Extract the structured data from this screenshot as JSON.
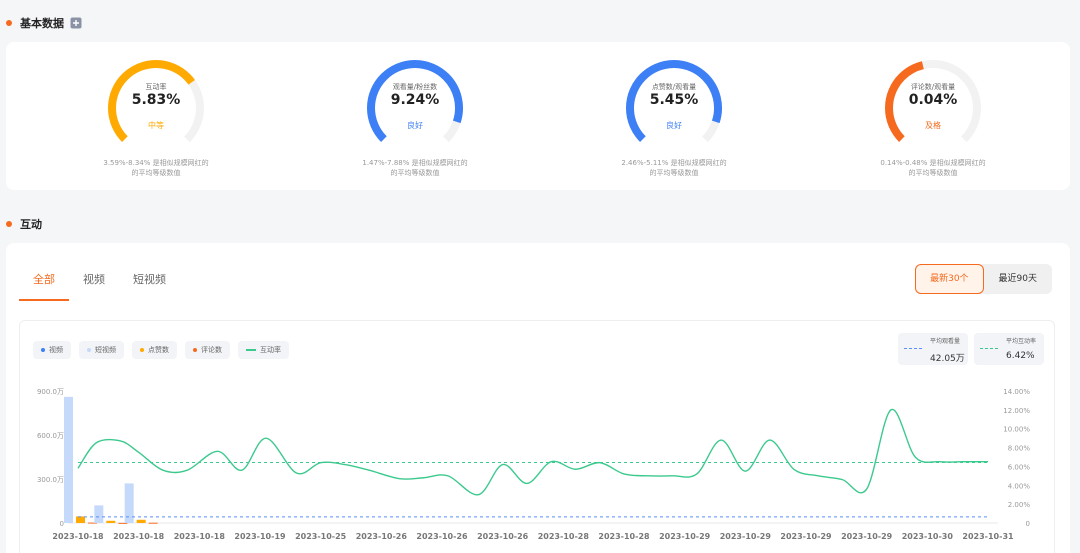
{
  "sections": {
    "basic_title": "基本数据",
    "interact_title": "互动"
  },
  "metrics": [
    {
      "label": "互动率",
      "value": "5.83%",
      "grade": "中等",
      "color": "#ffaa00",
      "ratio": 0.7,
      "desc_line1": "3.59%-8.34% 是相似规模网红的",
      "desc_line2": "的平均等级数值"
    },
    {
      "label": "观看量/粉丝数",
      "value": "9.24%",
      "grade": "良好",
      "color": "#3d7ff5",
      "ratio": 0.9,
      "desc_line1": "1.47%-7.88% 是相似规模网红的",
      "desc_line2": "的平均等级数值"
    },
    {
      "label": "点赞数/观看量",
      "value": "5.45%",
      "grade": "良好",
      "color": "#3d7ff5",
      "ratio": 0.9,
      "desc_line1": "2.46%-5.11% 是相似规模网红的",
      "desc_line2": "的平均等级数值"
    },
    {
      "label": "评论数/观看量",
      "value": "0.04%",
      "grade": "及格",
      "color": "#f56a1f",
      "ratio": 0.45,
      "desc_line1": "0.14%-0.48% 是相似规模网红的",
      "desc_line2": "的平均等级数值"
    }
  ],
  "tabs": [
    "全部",
    "视频",
    "短视频"
  ],
  "range": {
    "recent30": "最新30个",
    "recent90": "最近90天"
  },
  "legend": [
    {
      "label": "视频",
      "color": "#3d7ff5",
      "kind": "dot"
    },
    {
      "label": "短视频",
      "color": "#c5d9fb",
      "kind": "dot"
    },
    {
      "label": "点赞数",
      "color": "#ffaa00",
      "kind": "dot"
    },
    {
      "label": "评论数",
      "color": "#f56a1f",
      "kind": "dot"
    },
    {
      "label": "互动率",
      "color": "#3cc98e",
      "kind": "line"
    }
  ],
  "avg": {
    "views_title": "平均观看量",
    "views_value": "42.05万",
    "views_color": "#5b8ff9",
    "rate_title": "平均互动率",
    "rate_value": "6.42%",
    "rate_color": "#3cc98e"
  },
  "chart_data": {
    "type": "bar",
    "categories": [
      "2023-10-18",
      "2023-10-18",
      "2023-10-18",
      "2023-10-19",
      "2023-10-25",
      "2023-10-26",
      "2023-10-26",
      "2023-10-26",
      "2023-10-28",
      "2023-10-28",
      "2023-10-29",
      "2023-10-29",
      "2023-10-29",
      "2023-10-29",
      "2023-10-30",
      "2023-10-31"
    ],
    "y_left_ticks": [
      "0",
      "300.0万",
      "600.0万",
      "900.0万"
    ],
    "y_left_max": 900,
    "y_right_ticks": [
      "0",
      "2.00%",
      "4.00%",
      "6.00%",
      "8.00%",
      "10.00%",
      "12.00%",
      "14.00%"
    ],
    "y_right_max": 14,
    "bars": [
      {
        "x": 0,
        "short_video": 860,
        "likes": 45,
        "comments": 3
      },
      {
        "x": 0.5,
        "short_video": 120,
        "likes": 15,
        "comments": 1
      },
      {
        "x": 1,
        "short_video": 270,
        "likes": 22,
        "comments": 2
      }
    ],
    "interaction_rate_x": [
      0,
      0.3,
      0.7,
      1,
      1.4,
      1.8,
      2.3,
      2.7,
      3.1,
      3.6,
      4,
      4.4,
      4.8,
      5.3,
      5.7,
      6.1,
      6.6,
      7,
      7.4,
      7.8,
      8.2,
      8.6,
      9,
      9.4,
      9.8,
      10.2,
      10.6,
      11,
      11.4,
      11.8,
      12.2,
      12.6,
      13,
      13.4,
      13.8,
      14.2,
      14.6,
      15,
      15.4
    ],
    "interaction_rate_y": [
      5.8,
      8.5,
      8.7,
      7.5,
      5.6,
      5.6,
      7.6,
      5.6,
      9.0,
      5.3,
      6.4,
      6.2,
      5.6,
      4.7,
      4.8,
      5.0,
      3.0,
      6.2,
      4.2,
      6.5,
      5.7,
      6.4,
      5.2,
      5.0,
      5.0,
      5.2,
      8.8,
      5.5,
      8.8,
      5.7,
      5.0,
      4.6,
      3.6,
      12.0,
      7.0,
      6.5,
      6.5,
      6.5,
      6.5
    ],
    "avg_views": 42.05,
    "avg_rate": 6.42
  }
}
